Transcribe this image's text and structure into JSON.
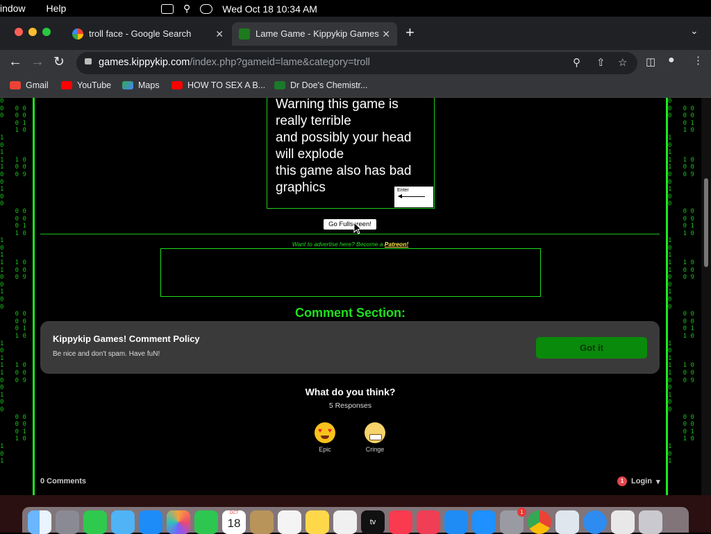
{
  "menubar": {
    "items": [
      "indow",
      "Help"
    ],
    "datetime": "Wed Oct 18  10:34 AM"
  },
  "tabs": [
    {
      "title": "troll face - Google Search",
      "icon": "google-icon"
    },
    {
      "title": "Lame Game - Kippykip Games",
      "icon": "kippykip-icon"
    }
  ],
  "omnibox": {
    "domain": "games.kippykip.com",
    "path": "/index.php?gameid=lame&category=troll"
  },
  "bookmarks": [
    "Gmail",
    "YouTube",
    "Maps",
    "HOW TO SEX A B...",
    "Dr Doe's Chemistr..."
  ],
  "game": {
    "lines": [
      "Warning this game is",
      "really terrible",
      "and possibly your head",
      "will explode",
      "this game also has bad",
      "graphics"
    ],
    "enter_label": "Enter",
    "fullscreen_button": "Go Fullscreen!"
  },
  "advertise": {
    "text": "Want to advertise here? Become a ",
    "link": "Patreon!"
  },
  "comments": {
    "section_title": "Comment Section:",
    "policy_title": "Kippykip Games! Comment Policy",
    "policy_text": "Be nice and don't spam. Have fuN!",
    "got_it": "Got it",
    "prompt": "What do you think?",
    "responses": "5 Responses",
    "reactions": [
      {
        "label": "Epic"
      },
      {
        "label": "Cringe"
      }
    ],
    "count": "0 Comments",
    "login": "Login",
    "login_badge": "1"
  },
  "dock": {
    "calendar_month": "OCT",
    "calendar_day": "18",
    "settings_badge": "1",
    "apple_tv": "tv"
  }
}
